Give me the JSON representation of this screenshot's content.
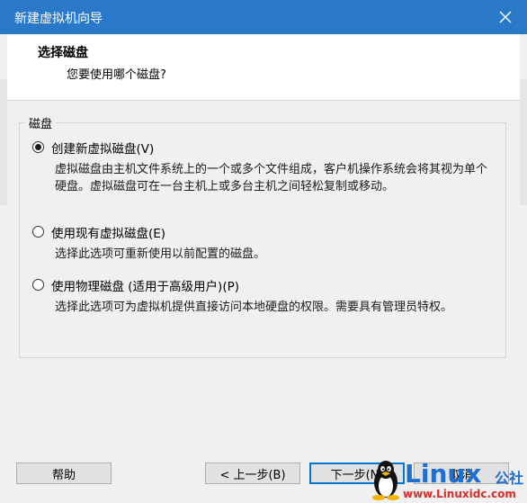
{
  "window": {
    "title": "新建虚拟机向导"
  },
  "header": {
    "title": "选择磁盘",
    "subtitle": "您要使用哪个磁盘?"
  },
  "group": {
    "legend": "磁盘"
  },
  "options": [
    {
      "label": "创建新虚拟磁盘(V)",
      "description": "虚拟磁盘由主机文件系统上的一个或多个文件组成，客户机操作系统会将其视为单个硬盘。虚拟磁盘可在一台主机上或多台主机之间轻松复制或移动。",
      "checked": true
    },
    {
      "label": "使用现有虚拟磁盘(E)",
      "description": "选择此选项可重新使用以前配置的磁盘。",
      "checked": false
    },
    {
      "label": "使用物理磁盘 (适用于高级用户)(P)",
      "description": "选择此选项可为虚拟机提供直接访问本地硬盘的权限。需要具有管理员特权。",
      "checked": false
    }
  ],
  "footer": {
    "help_label": "帮助",
    "back_label": "< 上一步(B)",
    "next_label": "下一步(N)",
    "cancel_label": "取消"
  },
  "watermark": {
    "brand": "Linux",
    "brand_suffix": "公社",
    "url": "www.Linuxidc.com"
  },
  "colors": {
    "titlebar": "#2a79c9",
    "accent": "#0078d7",
    "watermark_blue": "#1f6fd0",
    "watermark_red": "#d62d2d"
  }
}
